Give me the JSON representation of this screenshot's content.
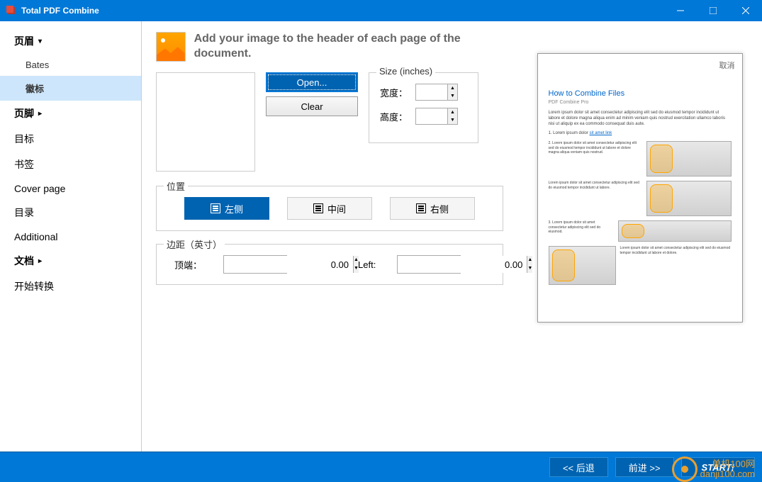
{
  "window": {
    "title": "Total PDF Combine"
  },
  "sidebar": {
    "items": [
      {
        "label": "页眉",
        "type": "header"
      },
      {
        "label": "Bates",
        "type": "sub"
      },
      {
        "label": "徽标",
        "type": "sub",
        "active": true
      },
      {
        "label": "页脚",
        "type": "header"
      },
      {
        "label": "目标",
        "type": "item"
      },
      {
        "label": "书签",
        "type": "item"
      },
      {
        "label": "Cover page",
        "type": "item"
      },
      {
        "label": "目录",
        "type": "item"
      },
      {
        "label": "Additional",
        "type": "item"
      },
      {
        "label": "文档",
        "type": "header"
      },
      {
        "label": "开始转换",
        "type": "item"
      }
    ]
  },
  "main": {
    "header_text": "Add your image to the header of each page of the document.",
    "open_btn": "Open...",
    "clear_btn": "Clear",
    "size_legend": "Size (inches)",
    "width_label": "宽度：",
    "height_label": "高度：",
    "width_value": "",
    "height_value": "",
    "position_legend": "位置",
    "pos_left": "左侧",
    "pos_center": "中间",
    "pos_right": "右侧",
    "margin_legend": "边距（英寸）",
    "margin_top_label": "顶端：",
    "margin_left_label": "Left:",
    "margin_top_value": "0.00",
    "margin_left_value": "0.00"
  },
  "preview": {
    "cancel": "取消",
    "title": "How to Combine Files",
    "subtitle": "PDF Combine Pro"
  },
  "footer": {
    "back": "<<  后退",
    "forward": "前进  >>",
    "start": "START!"
  },
  "watermark": {
    "line1": "单机100网",
    "line2": "danji100.com"
  }
}
